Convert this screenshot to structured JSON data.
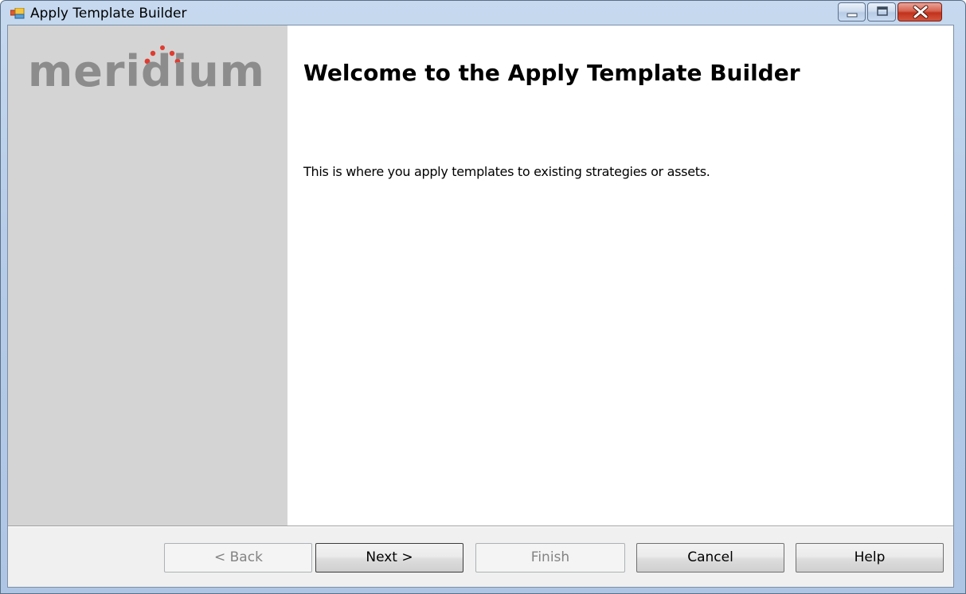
{
  "window": {
    "title": "Apply Template Builder"
  },
  "sidebar": {
    "logo_text": "meridium"
  },
  "main": {
    "heading": "Welcome to the Apply Template Builder",
    "description": "This is where you apply templates to existing strategies or assets."
  },
  "buttons": {
    "back": "< Back",
    "next": "Next >",
    "finish": "Finish",
    "cancel": "Cancel",
    "help": "Help"
  },
  "colors": {
    "logo_dots": "#e03c31",
    "logo_text": "#8c8c8c",
    "sidebar_bg": "#d4d4d4",
    "close_button": "#c1321c"
  },
  "icons": {
    "app": "apply-template-app-icon",
    "minimize": "minimize-icon",
    "maximize": "maximize-icon",
    "close": "close-icon"
  }
}
